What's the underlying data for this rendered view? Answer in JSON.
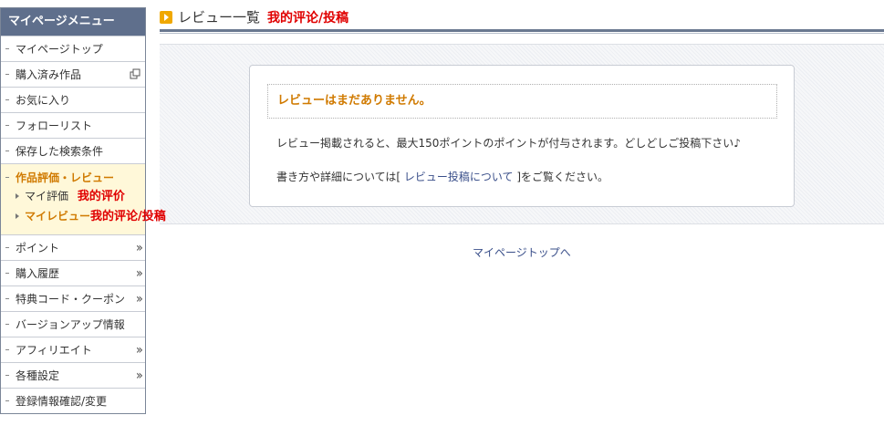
{
  "sidebar": {
    "title": "マイページメニュー",
    "items_top": [
      {
        "label": "マイページトップ"
      },
      {
        "label": "購入済み作品"
      },
      {
        "label": "お気に入り"
      },
      {
        "label": "フォローリスト"
      },
      {
        "label": "保存した検索条件"
      }
    ],
    "active_section": {
      "label": "作品評価・レビュー",
      "sub_items": [
        {
          "label": "マイ評価",
          "note": "我的评价"
        },
        {
          "label": "マイレビュー",
          "note": "我的评论/投稿"
        }
      ]
    },
    "items_bottom": [
      {
        "label": "ポイント"
      },
      {
        "label": "購入履歴"
      },
      {
        "label": "特典コード・クーポン"
      },
      {
        "label": "バージョンアップ情報"
      },
      {
        "label": "アフィリエイト"
      },
      {
        "label": "各種設定"
      },
      {
        "label": "登録情報確認/変更"
      }
    ]
  },
  "header": {
    "title": "レビュー一覧",
    "note": "我的评论/投稿"
  },
  "main": {
    "empty_message": "レビューはまだありません。",
    "info_line1": "レビュー掲載されると、最大150ポイントのポイントが付与されます。どしどしご投稿下さい♪",
    "info_line2_prefix": "書き方や詳細については[ ",
    "info_line2_link": "レビュー投稿について",
    "info_line2_suffix": " ]をご覧ください。",
    "mypage_top_link": "マイページトップへ"
  },
  "colors": {
    "sidebar_header": "#5f6f8c",
    "accent_orange": "#d07a00",
    "note_red": "#e00000",
    "link_blue": "#3a4f8a",
    "active_bg": "#fff8d9"
  }
}
